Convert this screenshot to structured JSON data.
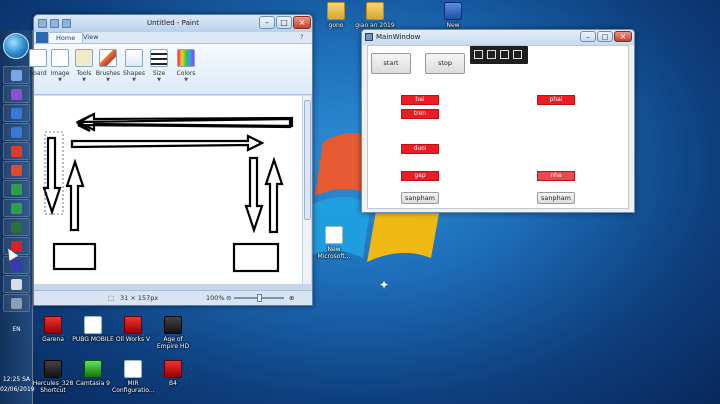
{
  "desktop": {
    "icons_top": [
      {
        "name": "gono-folder",
        "label": "gono",
        "kind": "folder"
      },
      {
        "name": "giao-an-folder",
        "label": "giao an 2019",
        "kind": "folder"
      },
      {
        "name": "new-document",
        "label": "New",
        "kind": "word"
      }
    ],
    "icons_bottom": [
      {
        "name": "garena-shortcut",
        "label": "Garena",
        "kind": "redsq"
      },
      {
        "name": "pubg-shortcut",
        "label": "PUBG MOBILE",
        "kind": "doc"
      },
      {
        "name": "oiiworks-shortcut",
        "label": "Oll Works V",
        "kind": "redsq"
      },
      {
        "name": "age-of-empires-shortcut",
        "label": "Age of Empire HD",
        "kind": "dark"
      },
      {
        "name": "hercules-shortcut",
        "label": "Hercules_328 Shortcut",
        "kind": "dark"
      },
      {
        "name": "camtasia-shortcut",
        "label": "Camtasia 9",
        "kind": "green"
      },
      {
        "name": "mir-configuration-shortcut",
        "label": "MIR Configuratio...",
        "kind": "doc"
      },
      {
        "name": "b4-shortcut",
        "label": "B4",
        "kind": "redsq"
      }
    ],
    "new_microsoft_icon": {
      "label": "New Microsoft..."
    }
  },
  "taskbar": {
    "language": "EN",
    "time": "12:25 SA",
    "date": "02/06/2019",
    "button_colors": [
      "#7aa7e0",
      "#8e4fd6",
      "#3a78d8",
      "#3a78d8",
      "#e23a2a",
      "#e24a2a",
      "#2fa04a",
      "#2fa04a",
      "#2a6f3a",
      "#e02020",
      "#3a3ab0",
      "#d8dde4",
      "#8aa0b0"
    ]
  },
  "paint": {
    "title": "Untitled - Paint",
    "tabs": [
      "Home",
      "View"
    ],
    "groups": [
      {
        "name": "clipboard-group",
        "label": "board"
      },
      {
        "name": "image-group",
        "label": "Image"
      },
      {
        "name": "tools-group",
        "label": "Tools"
      },
      {
        "name": "brushes-group",
        "label": "Brushes"
      },
      {
        "name": "shapes-group",
        "label": "Shapes"
      },
      {
        "name": "size-group",
        "label": "Size"
      },
      {
        "name": "colors-group",
        "label": "Colors"
      }
    ],
    "status_size": "31 × 157px",
    "zoom": "100%"
  },
  "mainwindow": {
    "title": "MainWindow",
    "start_label": "start",
    "stop_label": "stop",
    "labels": [
      {
        "name": "label-hai",
        "text": "hai"
      },
      {
        "name": "label-tren",
        "text": "tren"
      },
      {
        "name": "label-duoi",
        "text": "duoi"
      },
      {
        "name": "label-gap",
        "text": "gap"
      },
      {
        "name": "label-phai",
        "text": "phai"
      },
      {
        "name": "label-nha",
        "text": "nha"
      }
    ],
    "button_left_label": "sanpham",
    "button_right_label": "sanpham"
  }
}
